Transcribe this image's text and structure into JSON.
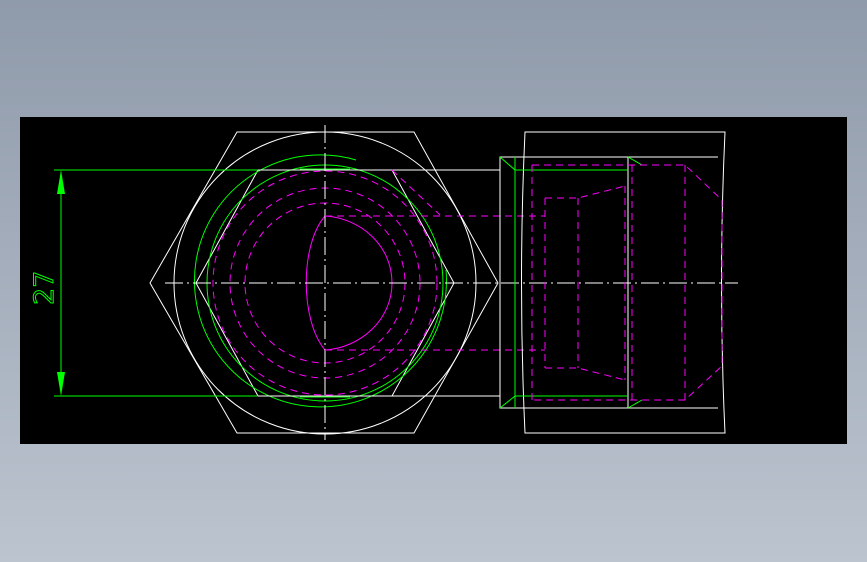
{
  "drawing": {
    "dimension_label": "27",
    "colors": {
      "background": "#000000",
      "outline": "#ffffff",
      "dimension": "#00ff00",
      "hidden": "#ff00ff",
      "centerline": "#ffffff"
    }
  }
}
